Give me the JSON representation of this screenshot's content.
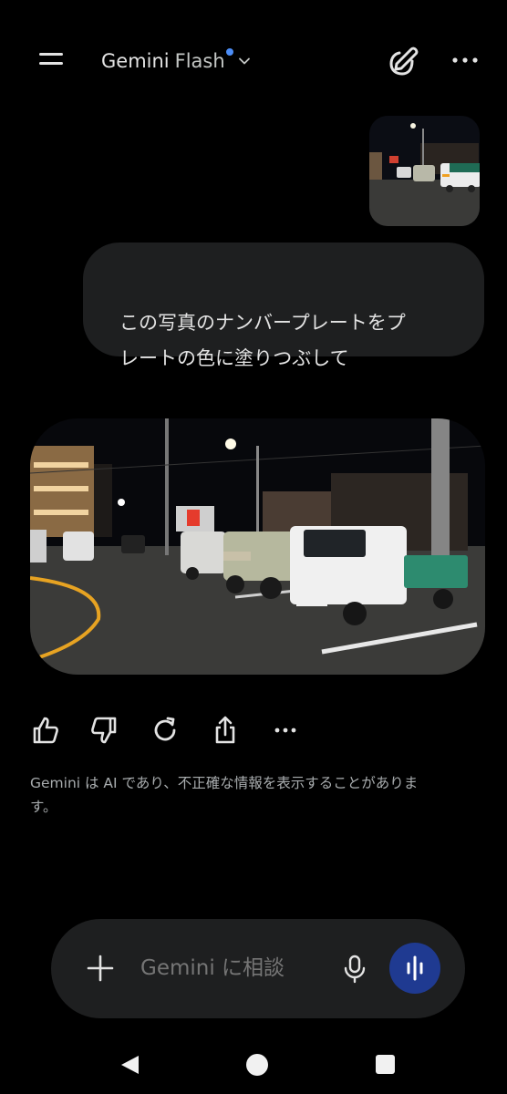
{
  "header": {
    "model_name": "Gemini",
    "model_variant": "Flash",
    "menu_icon": "hamburger-menu-icon",
    "new_chat_icon": "new-chat-icon",
    "more_icon": "more-horizontal-icon"
  },
  "conversation": {
    "user_image": {
      "description_icon": "photo-thumbnail"
    },
    "user_message": "この写真のナンバープレートをプ\nレートの色に塗りつぶして",
    "response_image": {
      "description_icon": "edited-photo"
    },
    "response_actions": [
      "thumb-up-icon",
      "thumb-down-icon",
      "regenerate-icon",
      "share-icon",
      "more-horizontal-icon"
    ]
  },
  "disclaimer": "Gemini は AI であり、不正確な情報を表示することがありま\nす。",
  "composer": {
    "placeholder": "Gemini に相談",
    "plus_icon": "plus-icon",
    "mic_icon": "microphone-icon",
    "live_icon": "live-audio-icon"
  },
  "colors": {
    "background": "#000000",
    "bubble": "#1e1f20",
    "accent_dot": "#4c8df6",
    "live_button": "#1f3a91"
  }
}
